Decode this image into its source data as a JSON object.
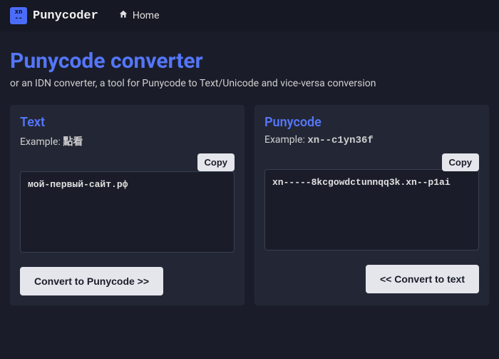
{
  "nav": {
    "brand": "Punycoder",
    "home_label": "Home"
  },
  "heading": {
    "title": "Punycode converter",
    "subtitle": "or an IDN converter, a tool for Punycode to Text/Unicode and vice-versa conversion"
  },
  "left": {
    "title": "Text",
    "example_prefix": "Example: ",
    "example_value": "點看",
    "copy_label": "Copy",
    "value": "мой-первый-сайт.рф",
    "convert_label": "Convert to Punycode >>"
  },
  "right": {
    "title": "Punycode",
    "example_prefix": "Example: ",
    "example_value": "xn--c1yn36f",
    "copy_label": "Copy",
    "value": "xn-----8kcgowdctunnqq3k.xn--p1ai",
    "convert_label": "<< Convert to text"
  }
}
